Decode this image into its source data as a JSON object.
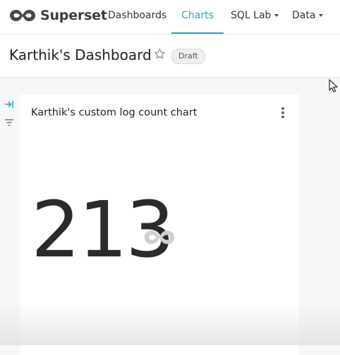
{
  "brand": {
    "name": "Superset",
    "logo_color": "#484848"
  },
  "nav": {
    "items": [
      {
        "label": "Dashboards",
        "active": false,
        "dropdown": false
      },
      {
        "label": "Charts",
        "active": true,
        "dropdown": false
      },
      {
        "label": "SQL Lab",
        "active": false,
        "dropdown": true
      },
      {
        "label": "Data",
        "active": false,
        "dropdown": true
      }
    ],
    "active_color": "#20a7c9"
  },
  "dashboard": {
    "title": "Karthik's Dashboard",
    "status_badge": "Draft",
    "favorite_icon": "star-outline-icon"
  },
  "filter_rail": {
    "expand_icon": "expand-right-icon",
    "filter_icon": "filter-icon"
  },
  "chart": {
    "title": "Karthik's custom log count chart",
    "menu_icon": "vertical-ellipsis-icon",
    "big_number": "213",
    "loading_icon": "loading-spinner-icon"
  }
}
